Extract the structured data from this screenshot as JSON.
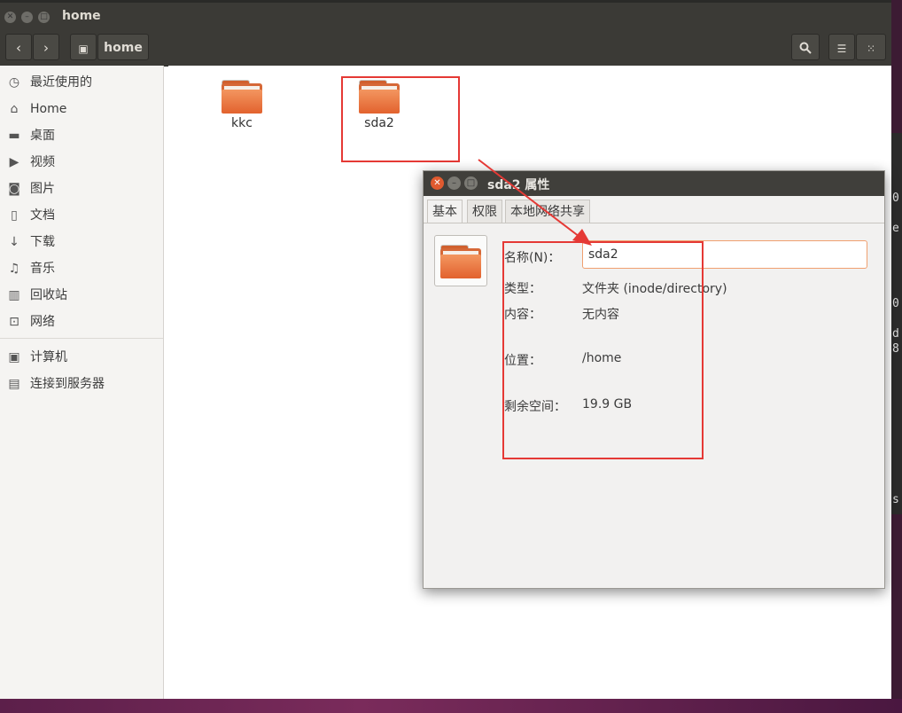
{
  "window": {
    "title": "home",
    "path_button_label": "home"
  },
  "sidebar": {
    "items": [
      {
        "label": "最近使用的",
        "icon": "clock-icon"
      },
      {
        "label": "Home",
        "icon": "home-icon"
      },
      {
        "label": "桌面",
        "icon": "folder-icon"
      },
      {
        "label": "视频",
        "icon": "video-icon"
      },
      {
        "label": "图片",
        "icon": "camera-icon"
      },
      {
        "label": "文档",
        "icon": "document-icon"
      },
      {
        "label": "下载",
        "icon": "download-icon"
      },
      {
        "label": "音乐",
        "icon": "music-icon"
      },
      {
        "label": "回收站",
        "icon": "trash-icon"
      },
      {
        "label": "网络",
        "icon": "network-icon"
      },
      {
        "label": "计算机",
        "icon": "computer-icon"
      },
      {
        "label": "连接到服务器",
        "icon": "server-icon"
      }
    ]
  },
  "content": {
    "files": [
      {
        "name": "kkc",
        "icon": "folder-icon"
      },
      {
        "name": "sda2",
        "icon": "folder-icon"
      }
    ]
  },
  "dialog": {
    "title": "sda2 属性",
    "tabs": [
      "基本",
      "权限",
      "本地网络共享"
    ],
    "active_tab": "基本",
    "name_label": "名称(N)：",
    "name_value": "sda2",
    "type_label": "类型：",
    "type_value": "文件夹 (inode/directory)",
    "contents_label": "内容：",
    "contents_value": "无内容",
    "location_label": "位置：",
    "location_value": "/home",
    "free_label": "剩余空间：",
    "free_value": "19.9 GB"
  },
  "annotation_color": "#e53935"
}
